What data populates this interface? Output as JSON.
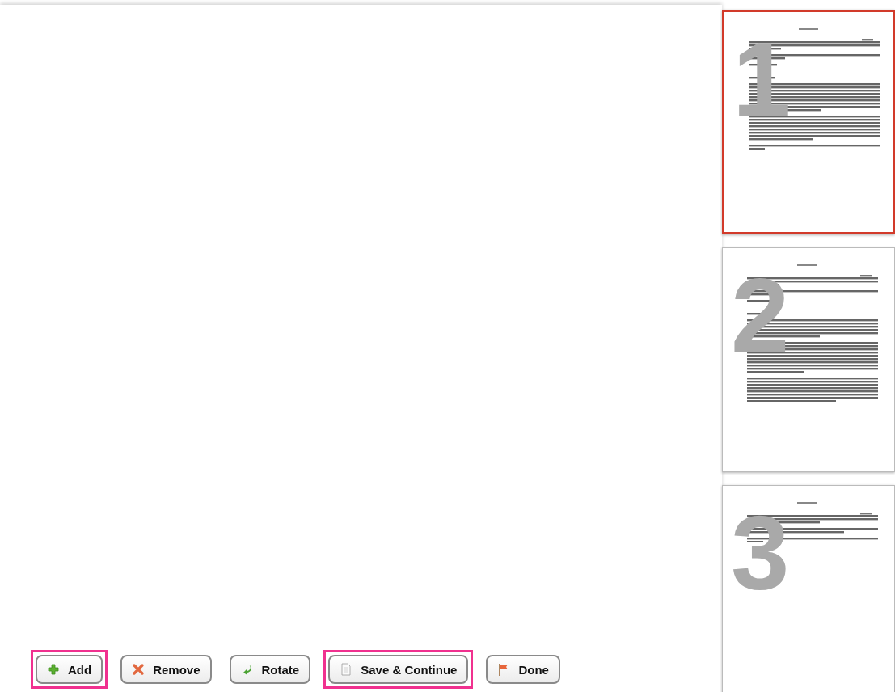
{
  "toolbar": {
    "buttons": [
      {
        "kind": "add",
        "label": "Add",
        "highlighted": true
      },
      {
        "kind": "remove",
        "label": "Remove",
        "highlighted": false
      },
      {
        "kind": "rotate",
        "label": "Rotate",
        "highlighted": false
      },
      {
        "kind": "save",
        "label": "Save & Continue",
        "highlighted": true
      },
      {
        "kind": "done",
        "label": "Done",
        "highlighted": false
      }
    ]
  },
  "pages": [
    {
      "number": "1",
      "selected": true
    },
    {
      "number": "2",
      "selected": false
    },
    {
      "number": "3",
      "selected": false
    }
  ]
}
